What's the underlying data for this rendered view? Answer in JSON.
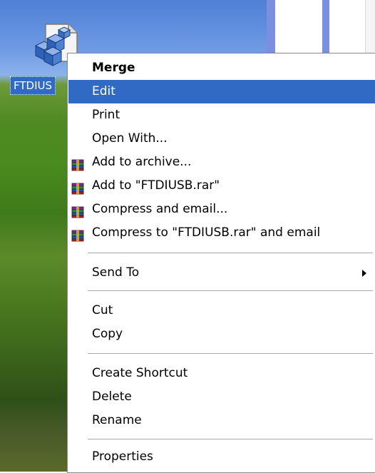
{
  "desktop": {
    "icon_label": "FTDIUS",
    "icon_name": "registry-file-icon"
  },
  "context_menu": {
    "items": [
      {
        "label": "Merge",
        "bold": true
      },
      {
        "label": "Edit",
        "selected": true
      },
      {
        "label": "Print"
      },
      {
        "label": "Open With..."
      },
      {
        "label": "Add to archive...",
        "icon": "winrar-icon"
      },
      {
        "label": "Add to \"FTDIUSB.rar\"",
        "icon": "winrar-icon"
      },
      {
        "label": "Compress and email...",
        "icon": "winrar-icon"
      },
      {
        "label": "Compress to \"FTDIUSB.rar\" and email",
        "icon": "winrar-icon"
      },
      {
        "label": "Send To",
        "submenu": true
      },
      {
        "label": "Cut"
      },
      {
        "label": "Copy"
      },
      {
        "label": "Create Shortcut"
      },
      {
        "label": "Delete"
      },
      {
        "label": "Rename"
      },
      {
        "label": "Properties"
      }
    ]
  },
  "colors": {
    "selection": "#316ac5",
    "menu_background": "#ffffff",
    "separator": "#a6a6a6"
  }
}
